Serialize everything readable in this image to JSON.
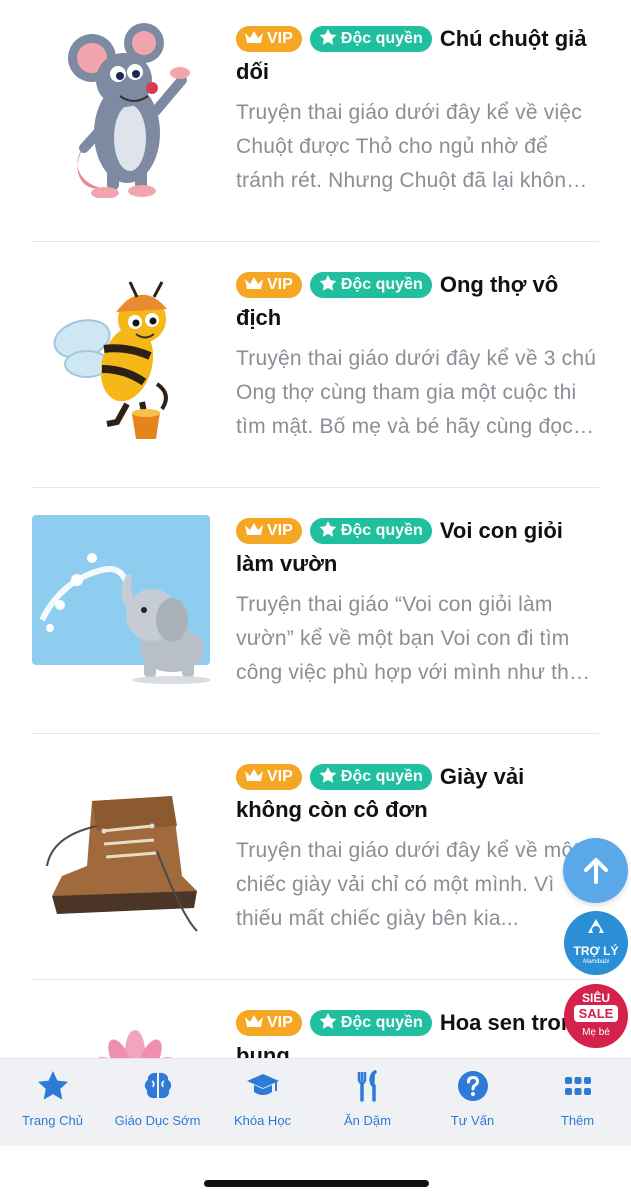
{
  "badges": {
    "vip": "VIP",
    "exclusive": "Độc quyền"
  },
  "stories": [
    {
      "title": "Chú chuột giả dối",
      "description": "Truyện thai giáo dưới đây kể về việc Chuột được Thỏ cho ngủ nhờ để tránh rét. Nhưng Chuột đã lại không biết ơn mà còn lừa dối Thỏ...",
      "thumbnail_icon": "mouse-illustration"
    },
    {
      "title": "Ong thợ vô địch",
      "description": "Truyện thai giáo dưới đây kể về 3 chú Ong thợ cùng tham gia một cuộc thi tìm mật. Bố mẹ và bé hãy cùng đọc nhé...",
      "thumbnail_icon": "bee-illustration"
    },
    {
      "title": "Voi con giỏi làm vườn",
      "description": "Truyện thai giáo “Voi con giỏi làm vườn” kể về một bạn Voi con đi tìm công việc phù hợp với mình như thế nào...",
      "thumbnail_icon": "elephant-illustration"
    },
    {
      "title": "Giày vải không còn cô đơn",
      "description": "Truyện thai giáo dưới đây kể về một chiếc giày vải chỉ có một mình. Vì thiếu mất chiếc giày bên kia...",
      "thumbnail_icon": "boot-illustration"
    },
    {
      "title": "Hoa sen trong bụng",
      "description": "",
      "thumbnail_icon": "lotus-illustration"
    }
  ],
  "floating": {
    "scroll_top_icon": "arrow-up-icon",
    "assistant_line1": "TRỢ LÝ",
    "assistant_line2": "Mamibabi",
    "sale_line1": "SIÊU",
    "sale_line2": "SALE",
    "sale_line3": "Mẹ bé"
  },
  "bottom_nav": [
    {
      "label": "Trang Chủ",
      "icon": "star-icon"
    },
    {
      "label": "Giáo Dục Sớm",
      "icon": "brain-icon"
    },
    {
      "label": "Khóa Học",
      "icon": "graduation-cap-icon"
    },
    {
      "label": "Ăn Dặm",
      "icon": "utensils-icon"
    },
    {
      "label": "Tư Vấn",
      "icon": "question-icon"
    },
    {
      "label": "Thêm",
      "icon": "grid-icon"
    }
  ],
  "colors": {
    "accent": "#2d7bd6",
    "vip": "#f5a623",
    "exclusive": "#1fbf9f",
    "sale": "#d4224a"
  }
}
